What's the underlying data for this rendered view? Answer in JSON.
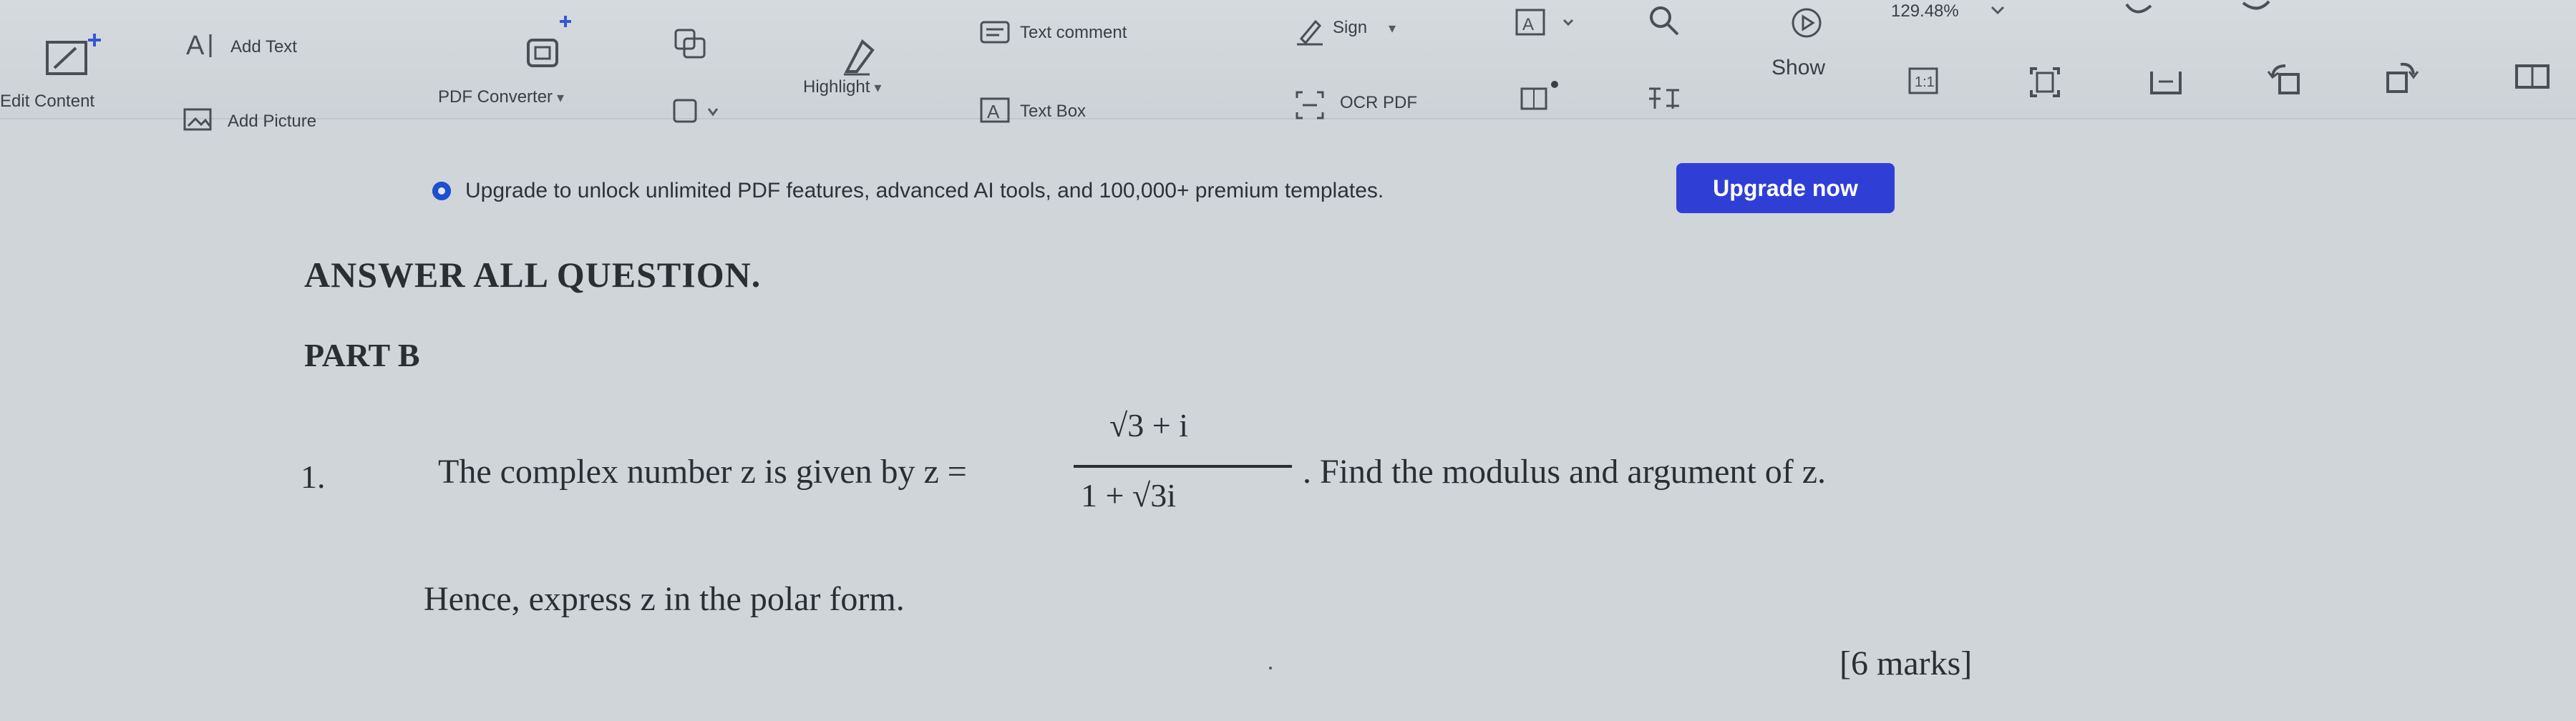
{
  "toolbar": {
    "add_text": "Add Text",
    "edit_content": "Edit Content",
    "add_picture": "Add Picture",
    "pdf_converter": "PDF Converter",
    "highlight": "Highlight",
    "text_comment": "Text comment",
    "text_box": "Text Box",
    "sign": "Sign",
    "ocr_pdf": "OCR PDF",
    "zoom": "129.48%",
    "show": "Show",
    "caret": "▾"
  },
  "banner": {
    "message": "Upgrade to unlock unlimited PDF features, advanced AI tools, and 100,000+ premium templates.",
    "button": "Upgrade now"
  },
  "document": {
    "heading": "ANSWER ALL QUESTION.",
    "part": "PART B",
    "question_number": "1.",
    "question_text": "The complex number z is given by z =",
    "numerator": "√3 + i",
    "denominator": "1 + √3i",
    "question_after": ". Find the modulus and argument of z.",
    "hence": "Hence, express z in the polar form.",
    "marks": "[6 marks]"
  },
  "colors": {
    "background": "#d0d5da",
    "accent": "#2f3fd6",
    "banner_dot": "#1f4fd1"
  }
}
